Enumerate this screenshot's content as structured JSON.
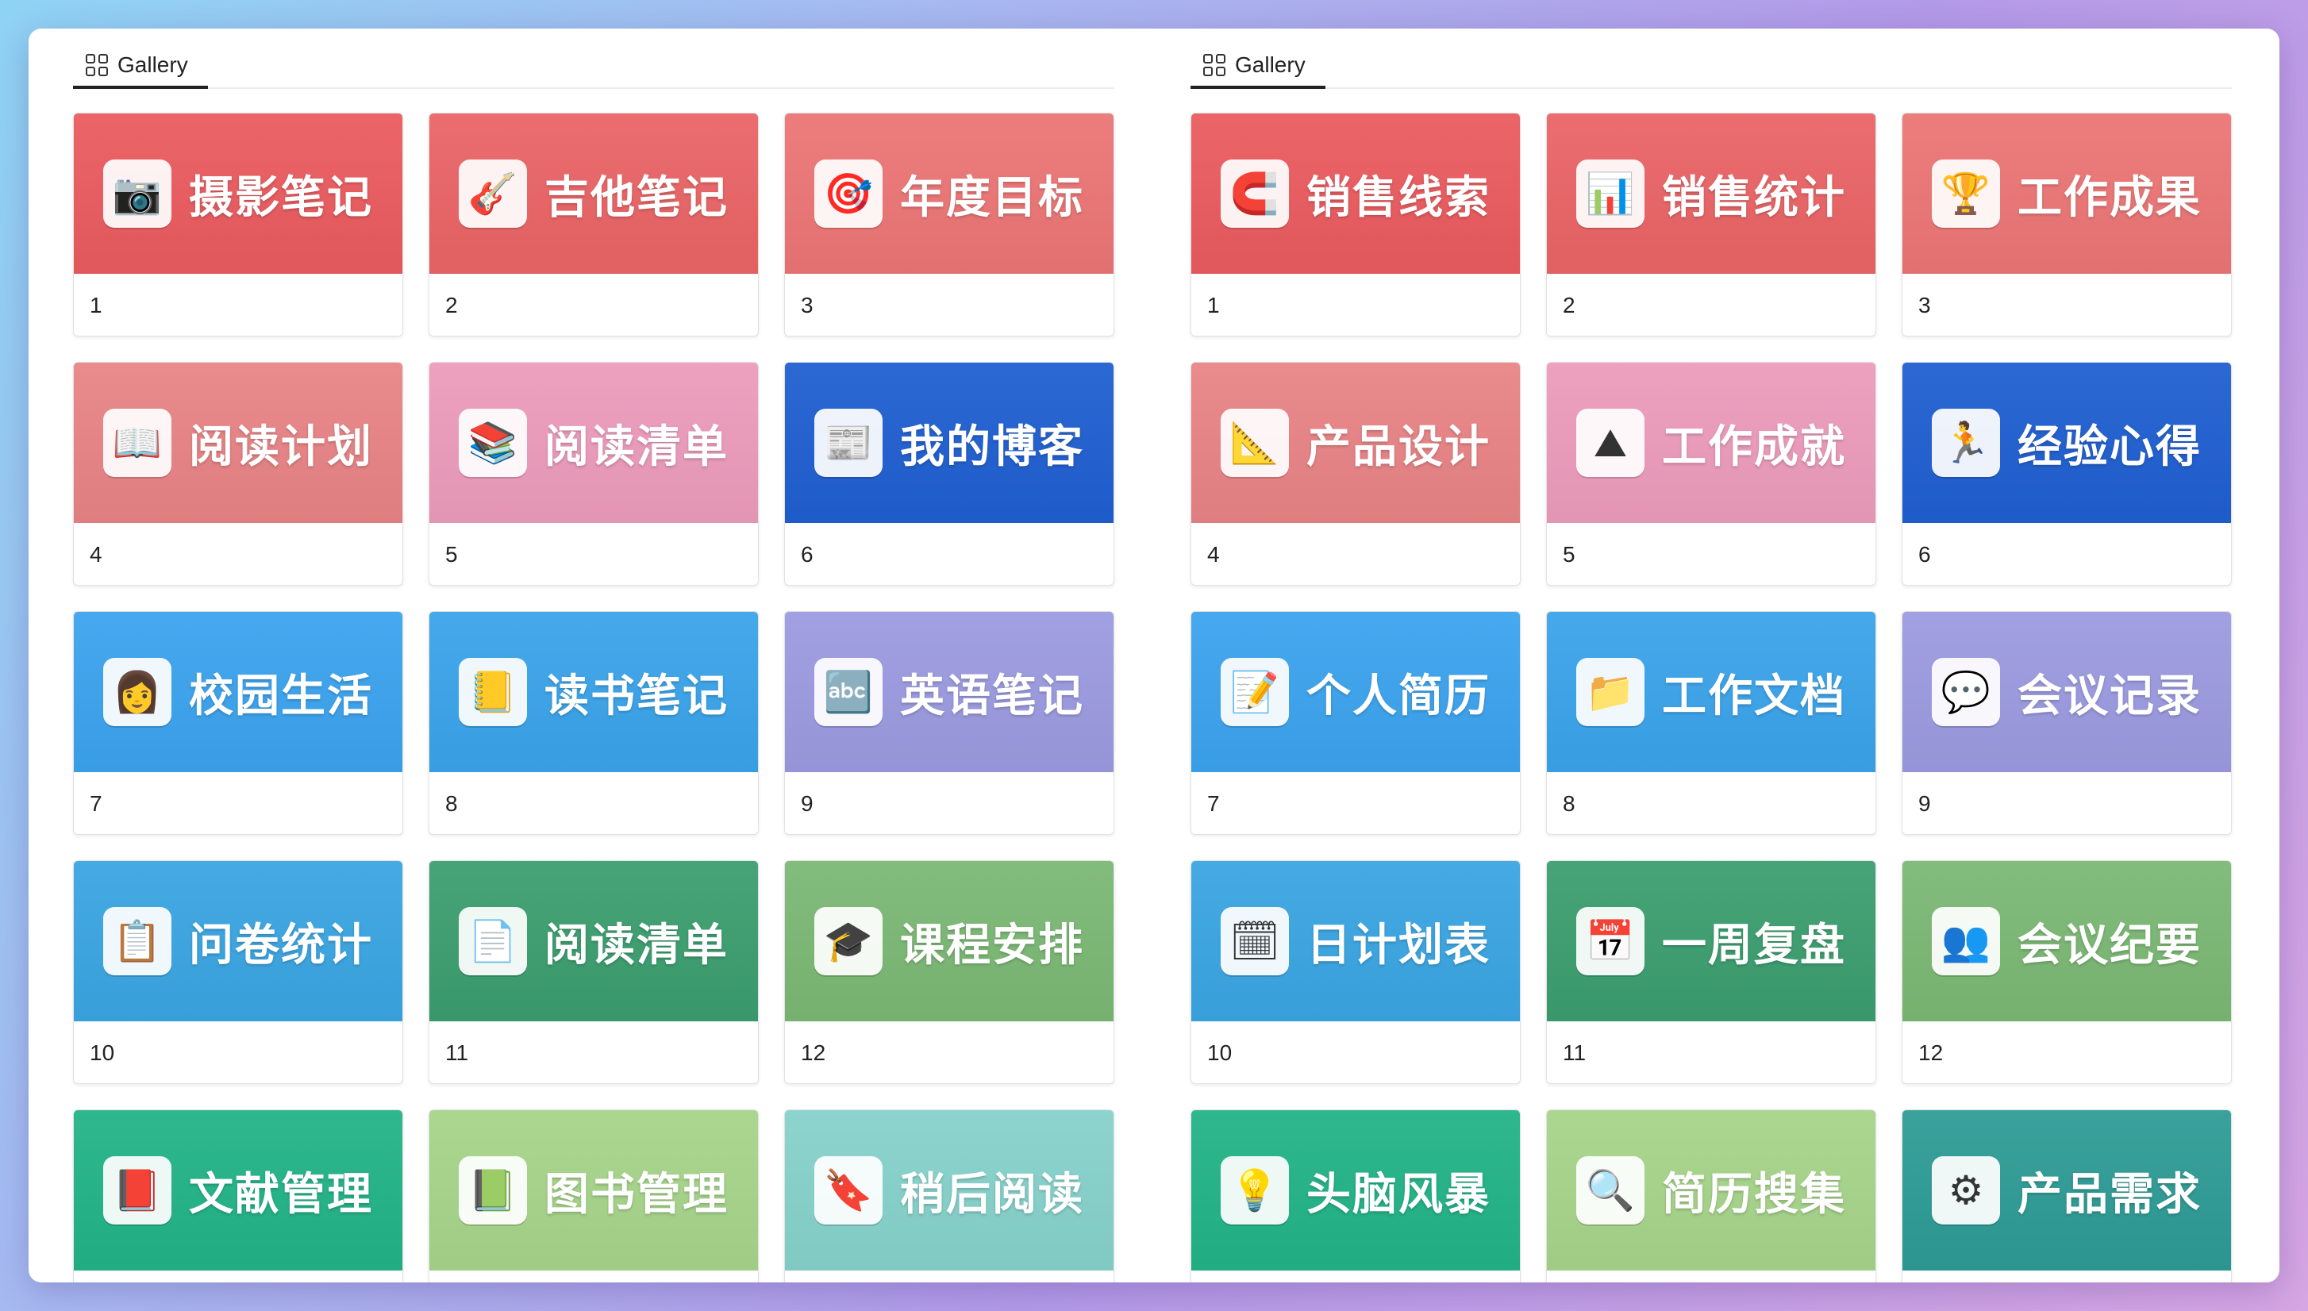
{
  "panels": [
    {
      "tab": "Gallery",
      "cards": [
        {
          "title": "摄影笔记",
          "caption": "1",
          "color": "#ea5b5f",
          "icon": "camera-icon",
          "glyph": "📷"
        },
        {
          "title": "吉他笔记",
          "caption": "2",
          "color": "#ea6466",
          "icon": "guitar-icon",
          "glyph": "🎸"
        },
        {
          "title": "年度目标",
          "caption": "3",
          "color": "#ec7575",
          "icon": "target-icon",
          "glyph": "🎯"
        },
        {
          "title": "阅读计划",
          "caption": "4",
          "color": "#e88385",
          "icon": "open-book-icon",
          "glyph": "📖"
        },
        {
          "title": "阅读清单",
          "caption": "5",
          "color": "#ec9bbb",
          "icon": "reading-hand-icon",
          "glyph": "📚"
        },
        {
          "title": "我的博客",
          "caption": "6",
          "color": "#1f5fd1",
          "icon": "blog-icon",
          "glyph": "📰"
        },
        {
          "title": "校园生活",
          "caption": "7",
          "color": "#3ba3ee",
          "icon": "student-icon",
          "glyph": "👩"
        },
        {
          "title": "读书笔记",
          "caption": "8",
          "color": "#3aa3ea",
          "icon": "notebook-icon",
          "glyph": "📒"
        },
        {
          "title": "英语笔记",
          "caption": "9",
          "color": "#9b9ae0",
          "icon": "english-board-icon",
          "glyph": "🔤"
        },
        {
          "title": "问卷统计",
          "caption": "10",
          "color": "#3aa5e2",
          "icon": "survey-icon",
          "glyph": "📋"
        },
        {
          "title": "阅读清单",
          "caption": "11",
          "color": "#3b9e6f",
          "icon": "document-icon",
          "glyph": "📄"
        },
        {
          "title": "课程安排",
          "caption": "12",
          "color": "#7bb874",
          "icon": "graduation-laptop-icon",
          "glyph": "🎓"
        },
        {
          "title": "文献管理",
          "caption": "",
          "color": "#22b386",
          "icon": "books-stack-icon",
          "glyph": "📕"
        },
        {
          "title": "图书管理",
          "caption": "",
          "color": "#a6d48a",
          "icon": "library-icon",
          "glyph": "📗"
        },
        {
          "title": "稍后阅读",
          "caption": "",
          "color": "#86d1cb",
          "icon": "read-more-icon",
          "glyph": "🔖"
        }
      ]
    },
    {
      "tab": "Gallery",
      "cards": [
        {
          "title": "销售线索",
          "caption": "1",
          "color": "#ea5b5f",
          "icon": "magnet-icon",
          "glyph": "🧲"
        },
        {
          "title": "销售统计",
          "caption": "2",
          "color": "#ea6466",
          "icon": "sales-chart-icon",
          "glyph": "📊"
        },
        {
          "title": "工作成果",
          "caption": "3",
          "color": "#ec7575",
          "icon": "trophy-team-icon",
          "glyph": "🏆"
        },
        {
          "title": "产品设计",
          "caption": "4",
          "color": "#e88385",
          "icon": "design-tools-icon",
          "glyph": "📐"
        },
        {
          "title": "工作成就",
          "caption": "5",
          "color": "#ec9bbb",
          "icon": "mountain-flag-icon",
          "glyph": "⛰"
        },
        {
          "title": "经验心得",
          "caption": "6",
          "color": "#1f5fd1",
          "icon": "stairs-runner-icon",
          "glyph": "🏃"
        },
        {
          "title": "个人简历",
          "caption": "7",
          "color": "#3ba3ee",
          "icon": "resume-icon",
          "glyph": "📝"
        },
        {
          "title": "工作文档",
          "caption": "8",
          "color": "#3aa3ea",
          "icon": "locked-folder-icon",
          "glyph": "📁"
        },
        {
          "title": "会议记录",
          "caption": "9",
          "color": "#9b9ae0",
          "icon": "meeting-icon",
          "glyph": "💬"
        },
        {
          "title": "日计划表",
          "caption": "10",
          "color": "#3aa5e2",
          "icon": "clipboard-calendar-icon",
          "glyph": "🗓"
        },
        {
          "title": "一周复盘",
          "caption": "11",
          "color": "#3b9e6f",
          "icon": "weekly-calendar-icon",
          "glyph": "📅"
        },
        {
          "title": "会议纪要",
          "caption": "12",
          "color": "#7bb874",
          "icon": "chat-people-icon",
          "glyph": "👥"
        },
        {
          "title": "头脑风暴",
          "caption": "",
          "color": "#22b386",
          "icon": "brain-bulb-icon",
          "glyph": "💡"
        },
        {
          "title": "简历搜集",
          "caption": "",
          "color": "#a6d48a",
          "icon": "resume-search-icon",
          "glyph": "🔍"
        },
        {
          "title": "产品需求",
          "caption": "",
          "color": "#2e9b95",
          "icon": "idea-gear-icon",
          "glyph": "⚙"
        }
      ]
    }
  ]
}
